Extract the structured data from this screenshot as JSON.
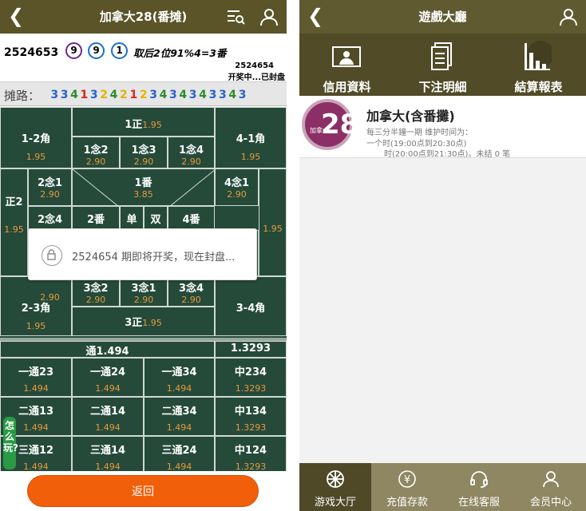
{
  "left": {
    "header": {
      "title": "加拿大28(番摊)",
      "back_icon": "chevron-left-icon",
      "filter_icon": "filter-list-icon",
      "user_icon": "user-icon"
    },
    "issue": {
      "number": "2524653",
      "balls": [
        {
          "value": "9",
          "color": "#6a2a8a"
        },
        {
          "value": "9",
          "color": "#1a6fd0"
        },
        {
          "value": "1",
          "color": "#1a6fd0"
        }
      ],
      "result_text": "取后2位91%4=3番",
      "next_number": "2524654",
      "state": "开奖中...已封盘"
    },
    "road": {
      "label": "摊路：",
      "sequence": [
        {
          "v": "3",
          "c": "blue"
        },
        {
          "v": "3",
          "c": "blue"
        },
        {
          "v": "4",
          "c": "green"
        },
        {
          "v": "1",
          "c": "red"
        },
        {
          "v": "3",
          "c": "blue"
        },
        {
          "v": "2",
          "c": "yellow"
        },
        {
          "v": "4",
          "c": "green"
        },
        {
          "v": "2",
          "c": "yellow"
        },
        {
          "v": "1",
          "c": "red"
        },
        {
          "v": "2",
          "c": "yellow"
        },
        {
          "v": "3",
          "c": "blue"
        },
        {
          "v": "4",
          "c": "green"
        },
        {
          "v": "3",
          "c": "blue"
        },
        {
          "v": "4",
          "c": "green"
        },
        {
          "v": "3",
          "c": "blue"
        },
        {
          "v": "4",
          "c": "green"
        },
        {
          "v": "3",
          "c": "blue"
        },
        {
          "v": "3",
          "c": "blue"
        },
        {
          "v": "4",
          "c": "green"
        },
        {
          "v": "3",
          "c": "blue"
        }
      ]
    },
    "grid": {
      "top_zheng": {
        "name": "1正",
        "odds": "1.95"
      },
      "corner_12": {
        "name": "1-2角",
        "odds": "1.95"
      },
      "corner_41": {
        "name": "4-1角",
        "odds": "1.95"
      },
      "nian_12": {
        "name": "1念2",
        "odds": "2.90"
      },
      "nian_13": {
        "name": "1念3",
        "odds": "2.90"
      },
      "nian_14": {
        "name": "1念4",
        "odds": "2.90"
      },
      "nian_21": {
        "name": "2念1",
        "odds": "2.90"
      },
      "fan_1": {
        "name": "1番",
        "odds": "3.85"
      },
      "nian_41": {
        "name": "4念1",
        "odds": "2.90"
      },
      "zheng_2": {
        "name": "正2",
        "odds": "1.95"
      },
      "odds_4_zheng": "1.95",
      "nian_24": {
        "name": "2念4"
      },
      "fan_2": {
        "name": "2番"
      },
      "dan": {
        "name": "单"
      },
      "shuang": {
        "name": "双"
      },
      "fan_4": {
        "name": "4番"
      },
      "nian_32": {
        "name": "3念2",
        "odds": "2.90"
      },
      "nian_31": {
        "name": "3念1",
        "odds": "2.90"
      },
      "nian_34": {
        "name": "3念4",
        "odds": "2.90"
      },
      "odds_23_left": "2.90",
      "corner_23": {
        "name": "2-3角",
        "odds": "1.95"
      },
      "corner_34": {
        "name": "3-4角"
      },
      "bottom_zheng": {
        "name": "3正",
        "odds": "1.95"
      },
      "tong_header": "通1.494",
      "tong_header_right": "1.3293",
      "rows": [
        [
          {
            "name": "一通23",
            "odds": "1.494"
          },
          {
            "name": "一通24",
            "odds": "1.494"
          },
          {
            "name": "一通34",
            "odds": "1.494"
          },
          {
            "name": "中234",
            "odds": "1.3293"
          }
        ],
        [
          {
            "name": "二通13",
            "odds": "1.494"
          },
          {
            "name": "二通14",
            "odds": "1.494"
          },
          {
            "name": "二通34",
            "odds": "1.494"
          },
          {
            "name": "中134",
            "odds": "1.3293"
          }
        ],
        [
          {
            "name": "三通12",
            "odds": "1.494"
          },
          {
            "name": "三通14",
            "odds": "1.494"
          },
          {
            "name": "三通24",
            "odds": "1.494"
          },
          {
            "name": "中124",
            "odds": "1.3293"
          }
        ]
      ]
    },
    "help_label": "怎么玩?",
    "toast": {
      "message": "2524654 期即将开奖，现在封盘...",
      "icon": "lock-icon"
    },
    "back_button": "返回"
  },
  "right": {
    "header": {
      "title": "遊戲大廳",
      "back_icon": "chevron-left-icon",
      "user_icon": "user-icon"
    },
    "tools": [
      {
        "label": "信用資料",
        "icon": "id-card-icon"
      },
      {
        "label": "下注明細",
        "icon": "document-list-icon"
      },
      {
        "label": "結算報表",
        "icon": "bar-chart-icon"
      }
    ],
    "game": {
      "logo_big": "28",
      "logo_small": "加拿大",
      "name": "加拿大(含番攤)",
      "lines": [
        "每三分半鐘一期 维护时间为：",
        "一个时(19:00点到20:30点)",
        "时(20:00点到21:30点)。未结 0 笔"
      ]
    },
    "tabs": [
      {
        "label": "游戏大厅",
        "icon": "wheel-icon",
        "active": true
      },
      {
        "label": "充值存款",
        "icon": "yen-coin-icon",
        "active": false
      },
      {
        "label": "在线客服",
        "icon": "headset-icon",
        "active": false
      },
      {
        "label": "会员中心",
        "icon": "member-icon",
        "active": false
      }
    ]
  },
  "colors": {
    "header": "#5a5428",
    "grid": "#254a3a",
    "odds": "#e89a3a",
    "return_button": "#f25f0b",
    "tabbar": "#8e8762"
  }
}
